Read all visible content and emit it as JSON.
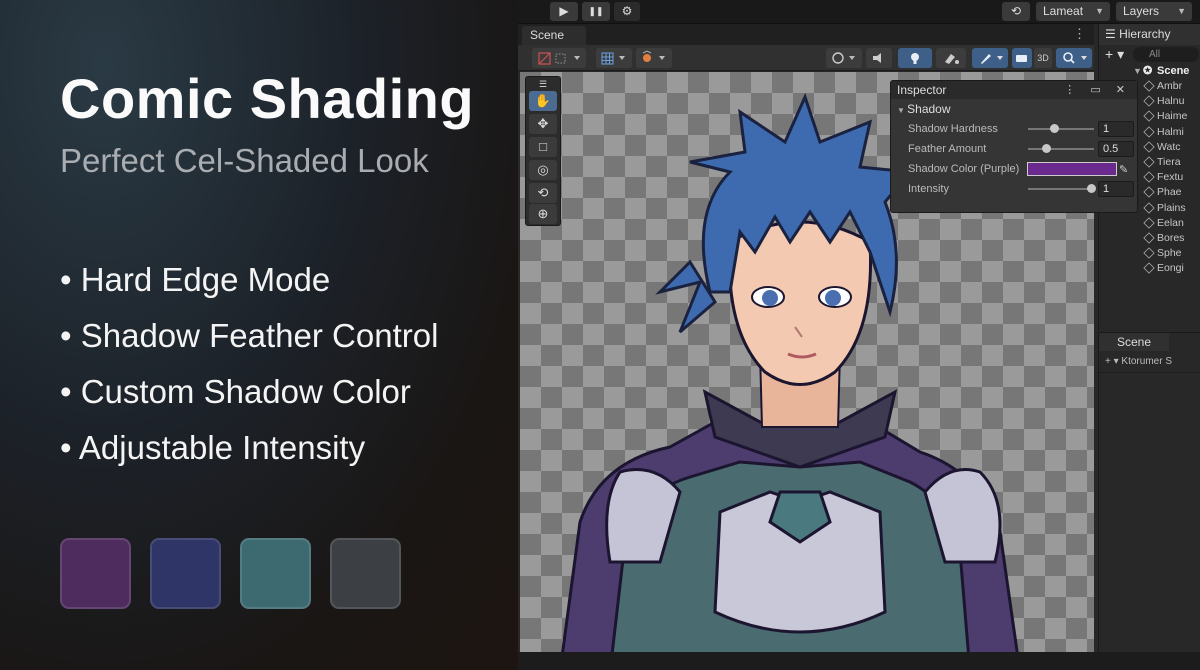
{
  "promo": {
    "title": "Comic Shading",
    "subtitle": "Perfect Cel-Shaded Look",
    "features": [
      "• Hard Edge Mode",
      "• Shadow Feather Control",
      "• Custom Shadow Color",
      "• Adjustable Intensity"
    ],
    "swatches": [
      "#4e2d5e",
      "#2f3566",
      "#3d6a70",
      "#3c3f44"
    ]
  },
  "toolbar": {
    "play_icon": "▶",
    "pause_icon": "❚❚",
    "step_icon": "⚙",
    "history_icon": "⟲",
    "layout_label": "Lameat",
    "layers_label": "Layers"
  },
  "scene_tab": {
    "label": "Scene",
    "more": "⋮"
  },
  "scene_toolbar": {
    "mode_3d": "3D"
  },
  "tools": [
    "☰",
    "✋",
    "✥",
    "□",
    "◎",
    "⟲",
    "⊕"
  ],
  "inspector": {
    "title": "Inspector",
    "section": "Shadow",
    "properties": [
      {
        "label": "Shadow Hardness",
        "value": "1",
        "slider": 0.4
      },
      {
        "label": "Feather Amount",
        "value": "0.5",
        "slider": 0.28
      },
      {
        "label": "Shadow Color (Purple)",
        "color": "#6b2a8e"
      },
      {
        "label": "Intensity",
        "value": "1",
        "slider": 0.95
      }
    ]
  },
  "hierarchy": {
    "tab": "Hierarchy",
    "search_placeholder": "All",
    "root": "Scene",
    "items": [
      "Ambr",
      "Halnu",
      "Haime",
      "Halmi",
      "Watc",
      "Tiera",
      "Fextu",
      "Phae",
      "Plains",
      "Eelan",
      "Bores",
      "Sphe",
      "Eongi"
    ]
  },
  "lower_panel": {
    "tab": "Scene",
    "tools": "+ ▾  Ktorumer  S"
  }
}
